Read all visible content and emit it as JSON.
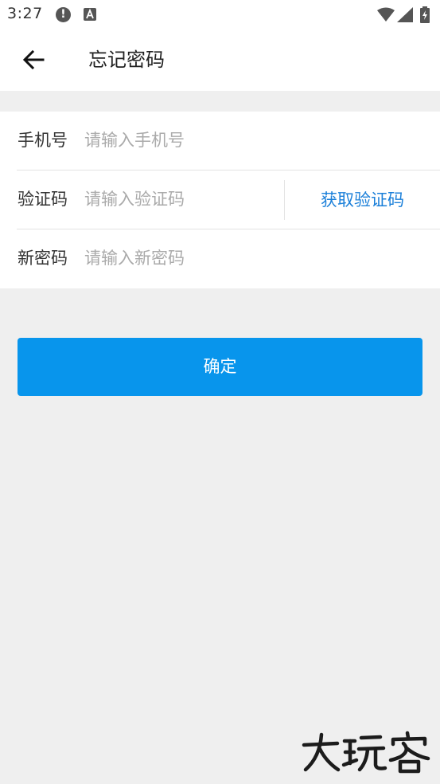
{
  "status_bar": {
    "time": "3:27"
  },
  "header": {
    "title": "忘记密码"
  },
  "form": {
    "phone": {
      "label": "手机号",
      "placeholder": "请输入手机号",
      "value": ""
    },
    "code": {
      "label": "验证码",
      "placeholder": "请输入验证码",
      "value": "",
      "get_code_label": "获取验证码"
    },
    "new_password": {
      "label": "新密码",
      "placeholder": "请输入新密码",
      "value": ""
    }
  },
  "confirm_label": "确定",
  "watermark_text": "大玩客",
  "icons": {
    "back": "arrow-left-icon",
    "alert": "alert-icon",
    "keyboard": "a-icon",
    "wifi": "wifi-icon",
    "signal": "signal-icon",
    "battery": "battery-charging-icon"
  },
  "colors": {
    "accent": "#0895ec",
    "link": "#1a7fd9",
    "background": "#efefef",
    "card": "#ffffff"
  }
}
